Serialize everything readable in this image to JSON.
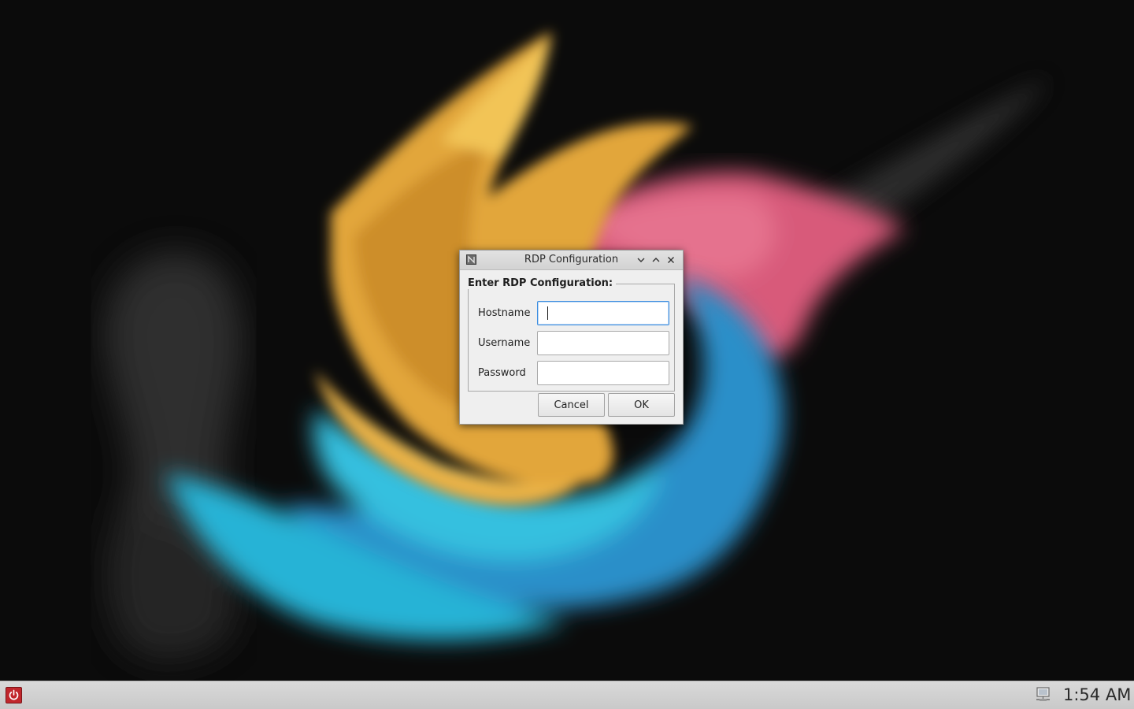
{
  "window": {
    "title": "RDP Configuration",
    "icons": {
      "app": "app-icon",
      "minimize": "chevron-down-icon",
      "maximize": "chevron-up-icon",
      "close": "close-icon"
    }
  },
  "form": {
    "group_title": "Enter RDP Configuration:",
    "hostname_label": "Hostname",
    "hostname_value": "",
    "username_label": "Username",
    "username_value": "",
    "password_label": "Password",
    "password_value": ""
  },
  "buttons": {
    "cancel_label": "Cancel",
    "ok_label": "OK"
  },
  "taskbar": {
    "start_icon": "power-icon",
    "tray_icon": "network-icon",
    "clock": "1:54 AM"
  },
  "colors": {
    "desktop_bg": "#0b0b0b",
    "dialog_bg": "#efefef",
    "focus_border": "#3d8ee0",
    "start_button": "#c1272d",
    "taskbar": "#d3d3d3"
  }
}
